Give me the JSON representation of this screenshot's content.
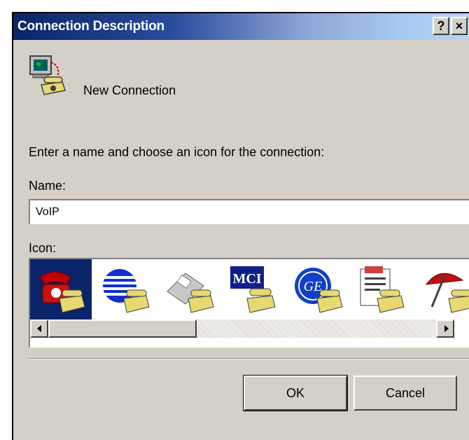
{
  "window": {
    "title": "Connection Description",
    "help_label": "?",
    "close_label": "×"
  },
  "connection": {
    "name": "New Connection"
  },
  "prompt": "Enter a name and choose an icon for the connection:",
  "name_field": {
    "label": "Name:",
    "value": "VoIP"
  },
  "icon_field": {
    "label": "Icon:",
    "icons": [
      {
        "name": "red-phone-icon",
        "selected": true
      },
      {
        "name": "globe-phone-icon",
        "selected": false
      },
      {
        "name": "fax-phone-icon",
        "selected": false
      },
      {
        "name": "mci-phone-icon",
        "label": "MCI",
        "selected": false
      },
      {
        "name": "ge-phone-icon",
        "label": "GE",
        "selected": false
      },
      {
        "name": "document-phone-icon",
        "selected": false
      },
      {
        "name": "umbrella-phone-icon",
        "selected": false
      }
    ]
  },
  "buttons": {
    "ok": "OK",
    "cancel": "Cancel"
  },
  "colors": {
    "title_bar_start": "#0a246a",
    "title_bar_end": "#a6caf0",
    "dialog_face": "#d4d0c8",
    "selection": "#0a246a"
  }
}
